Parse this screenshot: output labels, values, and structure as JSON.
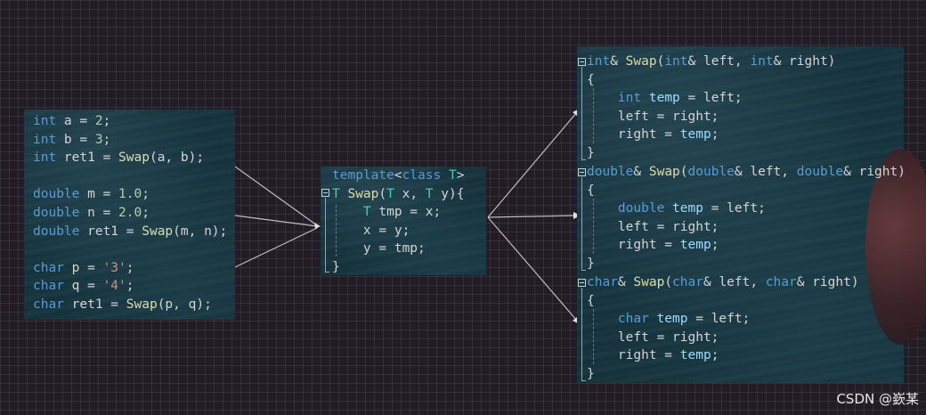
{
  "left_code": {
    "lines": [
      [
        [
          "kw",
          "int"
        ],
        [
          "id",
          " a = "
        ],
        [
          "num",
          "2"
        ],
        [
          "id",
          ";"
        ]
      ],
      [
        [
          "kw",
          "int"
        ],
        [
          "id",
          " b = "
        ],
        [
          "num",
          "3"
        ],
        [
          "id",
          ";"
        ]
      ],
      [
        [
          "kw",
          "int"
        ],
        [
          "id",
          " ret1 = "
        ],
        [
          "fn",
          "Swap"
        ],
        [
          "id",
          "(a, b);"
        ]
      ],
      [],
      [
        [
          "kw",
          "double"
        ],
        [
          "id",
          " m = "
        ],
        [
          "num",
          "1.0"
        ],
        [
          "id",
          ";"
        ]
      ],
      [
        [
          "kw",
          "double"
        ],
        [
          "id",
          " n = "
        ],
        [
          "num",
          "2.0"
        ],
        [
          "id",
          ";"
        ]
      ],
      [
        [
          "kw",
          "double"
        ],
        [
          "id",
          " ret1 = "
        ],
        [
          "fn",
          "Swap"
        ],
        [
          "id",
          "(m, n);"
        ]
      ],
      [],
      [
        [
          "kw",
          "char"
        ],
        [
          "id",
          " p = "
        ],
        [
          "str",
          "'3'"
        ],
        [
          "id",
          ";"
        ]
      ],
      [
        [
          "kw",
          "char"
        ],
        [
          "id",
          " q = "
        ],
        [
          "str",
          "'4'"
        ],
        [
          "id",
          ";"
        ]
      ],
      [
        [
          "kw",
          "char"
        ],
        [
          "id",
          " ret1 = "
        ],
        [
          "fn",
          "Swap"
        ],
        [
          "id",
          "(p, q);"
        ]
      ]
    ]
  },
  "template_code": {
    "lines": [
      [
        [
          "kw",
          "template"
        ],
        [
          "pl",
          "<"
        ],
        [
          "kw",
          "class"
        ],
        [
          "pl",
          " "
        ],
        [
          "ty",
          "T"
        ],
        [
          "pl",
          ">"
        ]
      ],
      [
        [
          "ty",
          "T"
        ],
        [
          "pl",
          " "
        ],
        [
          "fn",
          "Swap"
        ],
        [
          "pl",
          "("
        ],
        [
          "ty",
          "T"
        ],
        [
          "pl",
          " x, "
        ],
        [
          "ty",
          "T"
        ],
        [
          "pl",
          " y){"
        ]
      ],
      [
        [
          "pl",
          "    "
        ],
        [
          "ty",
          "T"
        ],
        [
          "pl",
          " tmp = x;"
        ]
      ],
      [
        [
          "pl",
          "    x = y;"
        ]
      ],
      [
        [
          "pl",
          "    y = tmp;"
        ]
      ],
      [
        [
          "pl",
          "}"
        ]
      ]
    ]
  },
  "instances": [
    {
      "lines": [
        [
          [
            "kw",
            "int"
          ],
          [
            "pl",
            "& "
          ],
          [
            "fn",
            "Swap"
          ],
          [
            "pl",
            "("
          ],
          [
            "kw",
            "int"
          ],
          [
            "pl",
            "& left, "
          ],
          [
            "kw",
            "int"
          ],
          [
            "pl",
            "& right)"
          ]
        ],
        [
          [
            "pl",
            "{"
          ]
        ],
        [
          [
            "pl",
            "    "
          ],
          [
            "kw",
            "int"
          ],
          [
            "pl",
            " "
          ],
          [
            "var",
            "temp"
          ],
          [
            "pl",
            " = left;"
          ]
        ],
        [
          [
            "pl",
            "    left = right;"
          ]
        ],
        [
          [
            "pl",
            "    right = "
          ],
          [
            "var",
            "temp"
          ],
          [
            "pl",
            ";"
          ]
        ],
        [
          [
            "pl",
            "}"
          ]
        ]
      ]
    },
    {
      "lines": [
        [
          [
            "kw",
            "double"
          ],
          [
            "pl",
            "& "
          ],
          [
            "fn",
            "Swap"
          ],
          [
            "pl",
            "("
          ],
          [
            "kw",
            "double"
          ],
          [
            "pl",
            "& left, "
          ],
          [
            "kw",
            "double"
          ],
          [
            "pl",
            "& right)"
          ]
        ],
        [
          [
            "pl",
            "{"
          ]
        ],
        [
          [
            "pl",
            "    "
          ],
          [
            "kw",
            "double"
          ],
          [
            "pl",
            " "
          ],
          [
            "var",
            "temp"
          ],
          [
            "pl",
            " = left;"
          ]
        ],
        [
          [
            "pl",
            "    left = right;"
          ]
        ],
        [
          [
            "pl",
            "    right = "
          ],
          [
            "var",
            "temp"
          ],
          [
            "pl",
            ";"
          ]
        ],
        [
          [
            "pl",
            "}"
          ]
        ]
      ]
    },
    {
      "lines": [
        [
          [
            "kw",
            "char"
          ],
          [
            "pl",
            "& "
          ],
          [
            "fn",
            "Swap"
          ],
          [
            "pl",
            "("
          ],
          [
            "kw",
            "char"
          ],
          [
            "pl",
            "& left, "
          ],
          [
            "kw",
            "char"
          ],
          [
            "pl",
            "& right)"
          ]
        ],
        [
          [
            "pl",
            "{"
          ]
        ],
        [
          [
            "pl",
            "    "
          ],
          [
            "kw",
            "char"
          ],
          [
            "pl",
            " "
          ],
          [
            "var",
            "temp"
          ],
          [
            "pl",
            " = left;"
          ]
        ],
        [
          [
            "pl",
            "    left = right;"
          ]
        ],
        [
          [
            "pl",
            "    right = "
          ],
          [
            "var",
            "temp"
          ],
          [
            "pl",
            ";"
          ]
        ],
        [
          [
            "pl",
            "}"
          ]
        ]
      ]
    }
  ],
  "watermark": "CSDN @嶔某"
}
